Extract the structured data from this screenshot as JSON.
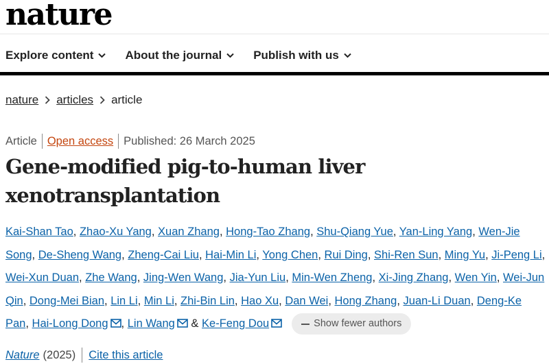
{
  "header": {
    "logo": "nature"
  },
  "nav": {
    "items": [
      {
        "label": "Explore content"
      },
      {
        "label": "About the journal"
      },
      {
        "label": "Publish with us"
      }
    ]
  },
  "breadcrumb": {
    "items": [
      "nature",
      "articles",
      "article"
    ]
  },
  "article": {
    "type": "Article",
    "access": "Open access",
    "published": "Published: 26 March 2025",
    "title": "Gene-modified pig-to-human liver xenotransplantation"
  },
  "authors": {
    "list": [
      "Kai-Shan Tao",
      "Zhao-Xu Yang",
      "Xuan Zhang",
      "Hong-Tao Zhang",
      "Shu-Qiang Yue",
      "Yan-Ling Yang",
      "Wen-Jie Song",
      "De-Sheng Wang",
      "Zheng-Cai Liu",
      "Hai-Min Li",
      "Yong Chen",
      "Rui Ding",
      "Shi-Ren Sun",
      "Ming Yu",
      "Ji-Peng Li",
      "Wei-Xun Duan",
      "Zhe Wang",
      "Jing-Wen Wang",
      "Jia-Yun Liu",
      "Min-Wen Zheng",
      "Xi-Jing Zhang",
      "Wen Yin",
      "Wei-Jun Qin",
      "Dong-Mei Bian",
      "Lin Li",
      "Min Li",
      "Zhi-Bin Lin",
      "Hao Xu",
      "Dan Wei",
      "Hong Zhang",
      "Juan-Li Duan",
      "Deng-Ke Pan",
      "Hai-Long Dong",
      "Lin Wang",
      "Ke-Feng Dou"
    ],
    "corresponding": [
      "Hai-Long Dong",
      "Lin Wang",
      "Ke-Feng Dou"
    ],
    "separator": ",",
    "ampersand": "&",
    "show_fewer_label": "Show fewer authors"
  },
  "citation": {
    "journal": "Nature",
    "year": "(2025)",
    "cite_label": "Cite this article"
  },
  "colors": {
    "link": "#0b62a8",
    "open_access": "#c4460f",
    "nav_bar": "#000000"
  },
  "icons": {
    "nav_dropdown": "chevron-down-icon",
    "breadcrumb_separator": "chevron-right-icon",
    "author_contact": "envelope-icon"
  }
}
